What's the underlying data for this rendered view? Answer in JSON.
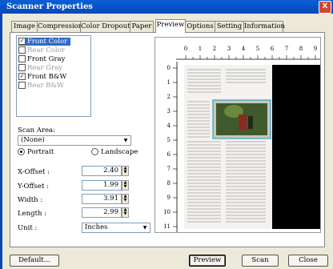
{
  "window": {
    "title": "Scanner Properties",
    "close_glyph": "X"
  },
  "tabs": [
    "Image",
    "Compression",
    "Color Dropout",
    "Paper",
    "Preview",
    "Options",
    "Setting",
    "Information"
  ],
  "image_list": [
    {
      "label": "Front Color",
      "checked": true,
      "selected": true
    },
    {
      "label": "Rear Color",
      "checked": false
    },
    {
      "label": "Front Gray",
      "checked": false
    },
    {
      "label": "Rear Gray",
      "checked": false
    },
    {
      "label": "Front B&W",
      "checked": true
    },
    {
      "label": "Rear B&W",
      "checked": false
    }
  ],
  "scan_area": {
    "label": "Scan Area:",
    "value": "(None)"
  },
  "orientation": {
    "portrait": "Portrait",
    "landscape": "Landscape",
    "selected": "portrait"
  },
  "fields": {
    "x_offset": {
      "label": "X-Offset :",
      "value": "2.40"
    },
    "y_offset": {
      "label": "Y-Offset :",
      "value": "1.99"
    },
    "width": {
      "label": "Width :",
      "value": "3.91"
    },
    "length": {
      "label": "Length :",
      "value": "2.99"
    }
  },
  "unit": {
    "label": "Unit :",
    "value": "Inches"
  },
  "ruler_top": [
    "0",
    "1",
    "2",
    "3",
    "4",
    "5",
    "6",
    "7",
    "8",
    "9"
  ],
  "ruler_left": [
    "0",
    "1",
    "2",
    "3",
    "4",
    "5",
    "6",
    "7",
    "8",
    "9",
    "10",
    "11"
  ],
  "buttons": {
    "defaults": "Default...",
    "preview": "Preview",
    "scan": "Scan",
    "close": "Close"
  },
  "colors": {
    "title_bar": "#0a5fd8",
    "selection": "#316ac5",
    "select_box": "#3aa0c8",
    "dialog_bg": "#ece9d8"
  },
  "icons": {
    "checkbox": "check-icon",
    "dropdown": "chevron-down-icon",
    "spinner": "spin-arrows-icon"
  }
}
